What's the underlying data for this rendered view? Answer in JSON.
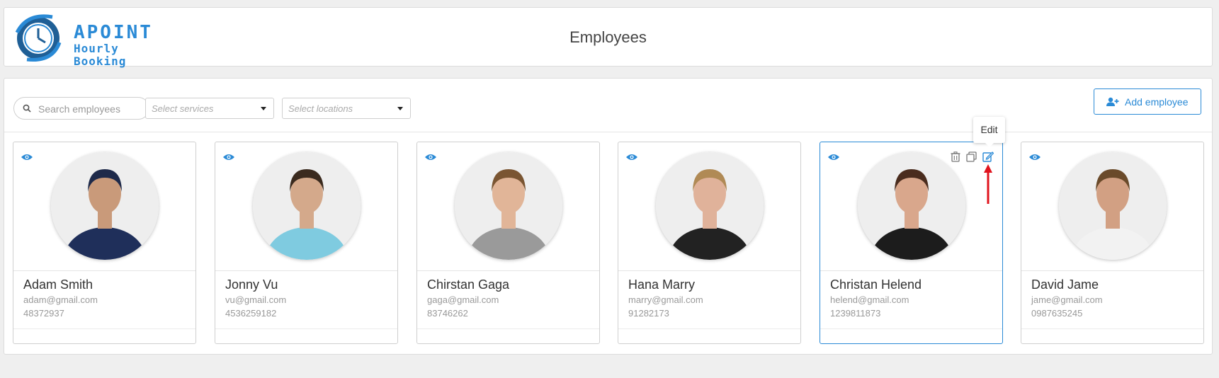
{
  "header": {
    "brand": "APOINT",
    "tagline": "Hourly Booking",
    "title": "Employees"
  },
  "toolbar": {
    "search_placeholder": "Search employees",
    "services_placeholder": "Select services",
    "locations_placeholder": "Select locations",
    "add_label": "Add employee"
  },
  "tooltip": "Edit",
  "colors": {
    "accent": "#2a8ad6",
    "annotation": "#e0141e"
  },
  "employees": [
    {
      "name": "Adam Smith",
      "email": "adam@gmail.com",
      "phone": "48372937",
      "skin": "#c99a7a",
      "hair": "#1e2a4a",
      "shirt": "#1f2f5a"
    },
    {
      "name": "Jonny Vu",
      "email": "vu@gmail.com",
      "phone": "4536259182",
      "skin": "#d4a98b",
      "hair": "#3a2a1e",
      "shirt": "#7fcbe0"
    },
    {
      "name": "Chirstan Gaga",
      "email": "gaga@gmail.com",
      "phone": "83746262",
      "skin": "#e1b598",
      "hair": "#7a5532",
      "shirt": "#9a9a9a"
    },
    {
      "name": "Hana Marry",
      "email": "marry@gmail.com",
      "phone": "91282173",
      "skin": "#e0b29a",
      "hair": "#b08a55",
      "shirt": "#222222"
    },
    {
      "name": "Christan Helend",
      "email": "helend@gmail.com",
      "phone": "1239811873",
      "skin": "#d9a78c",
      "hair": "#4a2c1e",
      "shirt": "#1c1c1c"
    },
    {
      "name": "David Jame",
      "email": "jame@gmail.com",
      "phone": "0987635245",
      "skin": "#d2a083",
      "hair": "#6a4a2a",
      "shirt": "#f2f2f2"
    }
  ]
}
